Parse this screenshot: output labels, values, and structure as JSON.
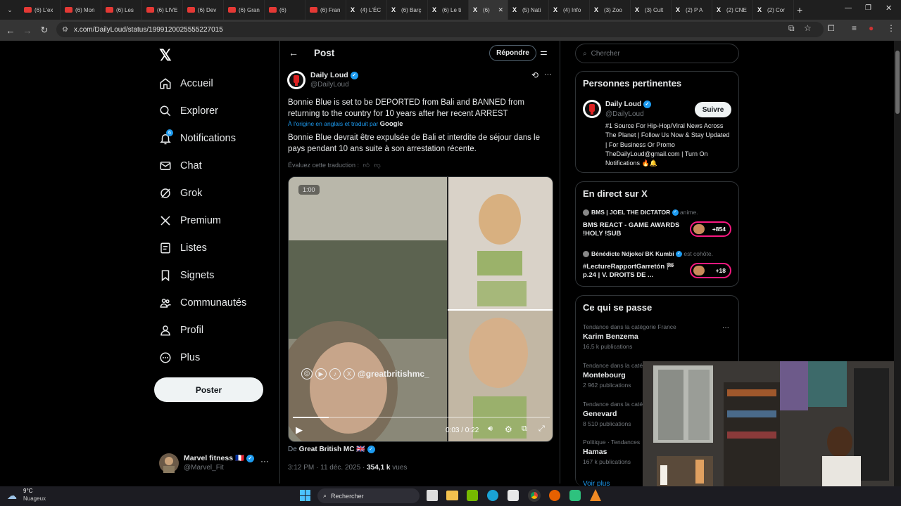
{
  "browser": {
    "tabs": [
      {
        "label": "(6) L'ex",
        "icon": "youtube-icon"
      },
      {
        "label": "(6) Mon",
        "icon": "youtube-icon"
      },
      {
        "label": "(6) Les",
        "icon": "youtube-icon"
      },
      {
        "label": "(6) LIVE",
        "icon": "youtube-icon"
      },
      {
        "label": "(6) Dev",
        "icon": "youtube-icon"
      },
      {
        "label": "(6) Gran",
        "icon": "youtube-icon"
      },
      {
        "label": "(6)",
        "icon": "youtube-icon"
      },
      {
        "label": "(6) Fran",
        "icon": "youtube-icon"
      },
      {
        "label": "(4) L'ÉC",
        "icon": "x-icon"
      },
      {
        "label": "(6) Barç",
        "icon": "x-icon"
      },
      {
        "label": "(6) Le ti",
        "icon": "x-icon"
      },
      {
        "label": "(6)",
        "icon": "x-icon"
      },
      {
        "label": "(5) Nati",
        "icon": "x-icon"
      },
      {
        "label": "(4) Info",
        "icon": "x-icon"
      },
      {
        "label": "(3) Zoo",
        "icon": "x-icon"
      },
      {
        "label": "(3) Cult",
        "icon": "x-icon"
      },
      {
        "label": "(2) P A",
        "icon": "x-icon"
      },
      {
        "label": "(2) CNE",
        "icon": "x-icon"
      },
      {
        "label": "(2) Cor",
        "icon": "x-icon"
      }
    ],
    "active_tab_index": 11,
    "url": "x.com/DailyLoud/status/1999120025555227015"
  },
  "nav": {
    "items": [
      {
        "label": "Accueil",
        "icon": "home-icon"
      },
      {
        "label": "Explorer",
        "icon": "search-icon"
      },
      {
        "label": "Notifications",
        "icon": "bell-icon",
        "badge": "6"
      },
      {
        "label": "Chat",
        "icon": "mail-icon"
      },
      {
        "label": "Grok",
        "icon": "grok-icon"
      },
      {
        "label": "Premium",
        "icon": "x-logo-icon"
      },
      {
        "label": "Listes",
        "icon": "list-icon"
      },
      {
        "label": "Signets",
        "icon": "bookmark-icon"
      },
      {
        "label": "Communautés",
        "icon": "communities-icon"
      },
      {
        "label": "Profil",
        "icon": "profile-icon"
      },
      {
        "label": "Plus",
        "icon": "more-circle-icon"
      }
    ],
    "post_button": "Poster",
    "account": {
      "name": "Marvel fitness 🇫🇷",
      "handle": "@Marvel_Fit"
    }
  },
  "post": {
    "header_title": "Post",
    "reply_button": "Répondre",
    "author_name": "Daily Loud",
    "author_handle": "@DailyLoud",
    "text_en": "Bonnie Blue is set to be DEPORTED from Bali and BANNED from returning to the country for 10 years after her recent ARREST",
    "translated_note": "À l'origine en anglais et traduit par",
    "translator": "Google",
    "text_fr": "Bonnie Blue devrait être expulsée de Bali et interdite de séjour dans le pays pendant 10 ans suite à son arrestation récente.",
    "rate_translation": "Évaluez cette traduction :",
    "video": {
      "badge": "1:00",
      "watermark": "@greatbritishmc_",
      "time": "0:03 / 0:22",
      "progress": 0.14
    },
    "from_prefix": "De",
    "from_source": "Great British MC 🇬🇧",
    "timestamp": "3:12 PM · 11 déc. 2025 · ",
    "views": "354,1 k",
    "views_label": " vues"
  },
  "sidebar": {
    "search_placeholder": "Chercher",
    "relevant": {
      "title": "Personnes pertinentes",
      "name": "Daily Loud",
      "handle": "@DailyLoud",
      "follow": "Suivre",
      "bio": "#1 Source For Hip-Hop/Viral News Across The Planet | Follow Us Now & Stay Updated | For Business Or Promo TheDailyLoud@gmail.com | Turn On Notifications 🔥🔔"
    },
    "live": {
      "title": "En direct sur X",
      "items": [
        {
          "host": "BMS | JOEL THE DICTATOR",
          "role": "anime.",
          "title": "BMS REACT - GAME AWARDS !HOLY !SUB",
          "count": "+854"
        },
        {
          "host": "Bénédicte Ndjoko/ BK Kumbi",
          "role": "est cohôte.",
          "title": "#LectureRapportGarretón 🏁 p.24 | V. DROITS DE ...",
          "count": "+18"
        }
      ]
    },
    "trends": {
      "title": "Ce qui se passe",
      "items": [
        {
          "meta": "Tendance dans la catégorie France",
          "name": "Karim Benzema",
          "count": "16,5 k publications"
        },
        {
          "meta": "Tendance dans la caté",
          "name": "Montebourg",
          "count": "2 962 publications"
        },
        {
          "meta": "Tendance dans la caté",
          "name": "Genevard",
          "count": "8 510 publications"
        },
        {
          "meta": "Politique · Tendances",
          "name": "Hamas",
          "count": "167 k publications"
        }
      ],
      "more": "Voir plus"
    }
  },
  "taskbar": {
    "weather_temp": "9°C",
    "weather_desc": "Nuageux",
    "search_placeholder": "Rechercher"
  }
}
